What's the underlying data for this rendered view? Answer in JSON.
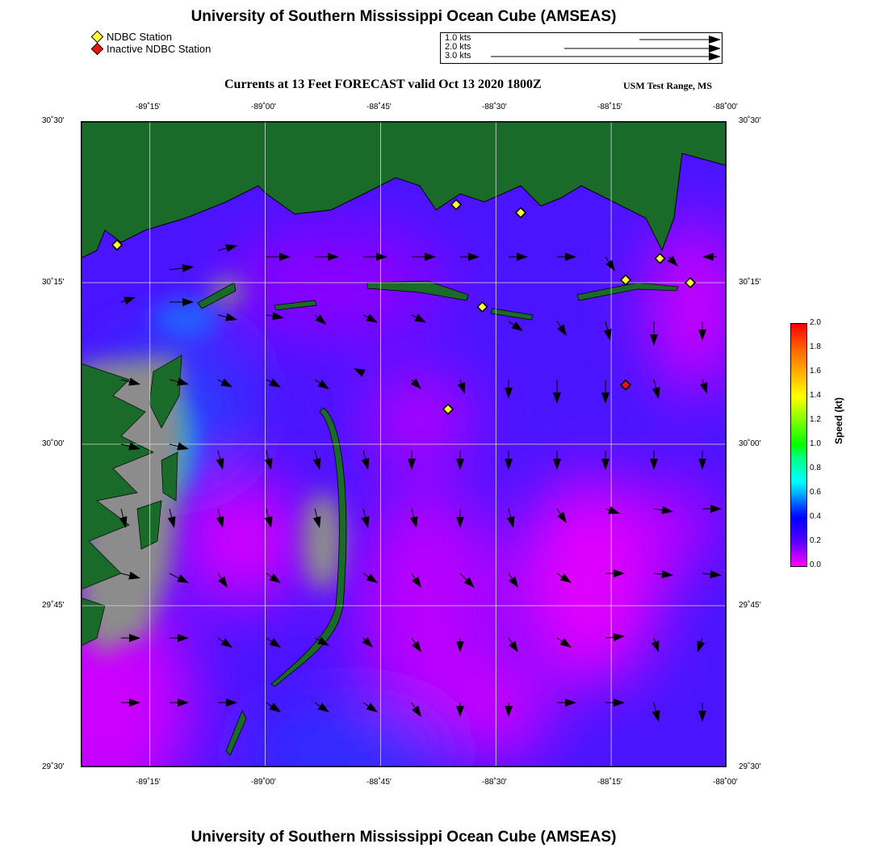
{
  "title": "University of Southern Mississippi Ocean Cube (AMSEAS)",
  "footer_title": "University of Southern Mississippi Ocean Cube (AMSEAS)",
  "legend": {
    "active": "NDBC Station",
    "inactive": "Inactive NDBC Station",
    "active_color": "#ffff33",
    "inactive_color": "#ee1111"
  },
  "speed_scale": [
    "1.0 kts",
    "2.0 kts",
    "3.0 kts"
  ],
  "subtitle": "Currents at 13 Feet FORECAST valid Oct 13 2020 1800Z",
  "region": "USM Test Range, MS",
  "lon_labels": [
    "-89˚15'",
    "-89˚00'",
    "-88˚45'",
    "-88˚30'",
    "-88˚15'",
    "-88˚00'"
  ],
  "lat_labels": [
    "30˚30'",
    "30˚15'",
    "30˚00'",
    "29˚45'",
    "29˚30'"
  ],
  "colorbar": {
    "title": "Speed (kt)",
    "ticks": [
      "0.0",
      "0.2",
      "0.4",
      "0.6",
      "0.8",
      "1.0",
      "1.2",
      "1.4",
      "1.6",
      "1.8",
      "2.0"
    ]
  },
  "colors": {
    "land": "#1a6a2a",
    "shallow": "#8c8c8c",
    "water_blue": "#3a10ff",
    "water_magenta": "#d000ff"
  },
  "map_extent": {
    "lon": [
      -89.3333,
      -88.0
    ],
    "lat": [
      29.5,
      30.5
    ]
  },
  "stations": [
    {
      "lon": -89.2583,
      "lat": 30.3083,
      "active": true
    },
    {
      "lon": -88.5583,
      "lat": 30.3708,
      "active": true
    },
    {
      "lon": -88.425,
      "lat": 30.3583,
      "active": true
    },
    {
      "lon": -88.1375,
      "lat": 30.2875,
      "active": true
    },
    {
      "lon": -88.2083,
      "lat": 30.2542,
      "active": true
    },
    {
      "lon": -88.075,
      "lat": 30.25,
      "active": true
    },
    {
      "lon": -88.5042,
      "lat": 30.2125,
      "active": true
    },
    {
      "lon": -88.575,
      "lat": 30.0542,
      "active": true
    },
    {
      "lon": -88.2083,
      "lat": 30.0917,
      "active": false
    }
  ],
  "current_vectors": [
    {
      "lon": -89.25,
      "lat": 30.22,
      "u": 0.15,
      "v": 0.05
    },
    {
      "lon": -89.15,
      "lat": 30.22,
      "u": 0.25,
      "v": 0.0
    },
    {
      "lon": -89.05,
      "lat": 30.2,
      "u": 0.2,
      "v": -0.05
    },
    {
      "lon": -88.95,
      "lat": 30.2,
      "u": 0.18,
      "v": -0.03
    },
    {
      "lon": -89.15,
      "lat": 30.27,
      "u": 0.25,
      "v": 0.03
    },
    {
      "lon": -89.05,
      "lat": 30.3,
      "u": 0.2,
      "v": 0.05
    },
    {
      "lon": -88.95,
      "lat": 30.29,
      "u": 0.25,
      "v": 0.0
    },
    {
      "lon": -88.85,
      "lat": 30.29,
      "u": 0.25,
      "v": 0.0
    },
    {
      "lon": -88.75,
      "lat": 30.29,
      "u": 0.25,
      "v": 0.0
    },
    {
      "lon": -88.65,
      "lat": 30.29,
      "u": 0.25,
      "v": 0.0
    },
    {
      "lon": -88.55,
      "lat": 30.29,
      "u": 0.2,
      "v": 0.0
    },
    {
      "lon": -88.45,
      "lat": 30.29,
      "u": 0.2,
      "v": 0.0
    },
    {
      "lon": -88.35,
      "lat": 30.29,
      "u": 0.2,
      "v": 0.0
    },
    {
      "lon": -88.25,
      "lat": 30.29,
      "u": 0.1,
      "v": -0.15
    },
    {
      "lon": -88.12,
      "lat": 30.29,
      "u": 0.1,
      "v": -0.1
    },
    {
      "lon": -88.02,
      "lat": 30.29,
      "u": -0.15,
      "v": 0.0
    },
    {
      "lon": -88.85,
      "lat": 30.2,
      "u": 0.12,
      "v": -0.1
    },
    {
      "lon": -88.75,
      "lat": 30.2,
      "u": 0.15,
      "v": -0.08
    },
    {
      "lon": -88.65,
      "lat": 30.2,
      "u": 0.15,
      "v": -0.08
    },
    {
      "lon": -88.45,
      "lat": 30.19,
      "u": 0.15,
      "v": -0.1
    },
    {
      "lon": -88.35,
      "lat": 30.19,
      "u": 0.1,
      "v": -0.15
    },
    {
      "lon": -88.25,
      "lat": 30.19,
      "u": 0.05,
      "v": -0.2
    },
    {
      "lon": -88.15,
      "lat": 30.19,
      "u": 0.0,
      "v": -0.25
    },
    {
      "lon": -88.05,
      "lat": 30.19,
      "u": 0.0,
      "v": -0.2
    },
    {
      "lon": -89.25,
      "lat": 30.1,
      "u": 0.2,
      "v": -0.05
    },
    {
      "lon": -89.15,
      "lat": 30.1,
      "u": 0.2,
      "v": -0.05
    },
    {
      "lon": -89.05,
      "lat": 30.1,
      "u": 0.15,
      "v": -0.08
    },
    {
      "lon": -88.95,
      "lat": 30.1,
      "u": 0.15,
      "v": -0.08
    },
    {
      "lon": -88.85,
      "lat": 30.1,
      "u": 0.15,
      "v": -0.1
    },
    {
      "lon": -88.75,
      "lat": 30.11,
      "u": -0.1,
      "v": 0.05
    },
    {
      "lon": -88.65,
      "lat": 30.1,
      "u": 0.1,
      "v": -0.1
    },
    {
      "lon": -88.55,
      "lat": 30.1,
      "u": 0.05,
      "v": -0.15
    },
    {
      "lon": -88.45,
      "lat": 30.1,
      "u": 0.0,
      "v": -0.2
    },
    {
      "lon": -88.35,
      "lat": 30.1,
      "u": 0.0,
      "v": -0.25
    },
    {
      "lon": -88.25,
      "lat": 30.1,
      "u": 0.0,
      "v": -0.25
    },
    {
      "lon": -88.15,
      "lat": 30.1,
      "u": 0.05,
      "v": -0.2
    },
    {
      "lon": -88.05,
      "lat": 30.1,
      "u": 0.05,
      "v": -0.15
    },
    {
      "lon": -89.25,
      "lat": 30.0,
      "u": 0.2,
      "v": -0.05
    },
    {
      "lon": -89.15,
      "lat": 30.0,
      "u": 0.2,
      "v": -0.05
    },
    {
      "lon": -89.05,
      "lat": 29.99,
      "u": 0.05,
      "v": -0.2
    },
    {
      "lon": -88.95,
      "lat": 29.99,
      "u": 0.05,
      "v": -0.2
    },
    {
      "lon": -88.85,
      "lat": 29.99,
      "u": 0.05,
      "v": -0.2
    },
    {
      "lon": -88.75,
      "lat": 29.99,
      "u": 0.05,
      "v": -0.2
    },
    {
      "lon": -88.65,
      "lat": 29.99,
      "u": 0.0,
      "v": -0.2
    },
    {
      "lon": -88.55,
      "lat": 29.99,
      "u": 0.0,
      "v": -0.2
    },
    {
      "lon": -88.45,
      "lat": 29.99,
      "u": 0.0,
      "v": -0.2
    },
    {
      "lon": -88.35,
      "lat": 29.99,
      "u": 0.0,
      "v": -0.2
    },
    {
      "lon": -88.25,
      "lat": 29.99,
      "u": 0.0,
      "v": -0.2
    },
    {
      "lon": -88.15,
      "lat": 29.99,
      "u": 0.0,
      "v": -0.2
    },
    {
      "lon": -88.05,
      "lat": 29.99,
      "u": 0.0,
      "v": -0.2
    },
    {
      "lon": -89.25,
      "lat": 29.9,
      "u": 0.05,
      "v": -0.2
    },
    {
      "lon": -89.15,
      "lat": 29.9,
      "u": 0.05,
      "v": -0.2
    },
    {
      "lon": -89.05,
      "lat": 29.9,
      "u": 0.05,
      "v": -0.2
    },
    {
      "lon": -88.95,
      "lat": 29.9,
      "u": 0.05,
      "v": -0.2
    },
    {
      "lon": -88.85,
      "lat": 29.9,
      "u": 0.05,
      "v": -0.2
    },
    {
      "lon": -88.75,
      "lat": 29.9,
      "u": 0.05,
      "v": -0.2
    },
    {
      "lon": -88.65,
      "lat": 29.9,
      "u": 0.05,
      "v": -0.2
    },
    {
      "lon": -88.55,
      "lat": 29.9,
      "u": 0.0,
      "v": -0.2
    },
    {
      "lon": -88.45,
      "lat": 29.9,
      "u": 0.05,
      "v": -0.2
    },
    {
      "lon": -88.35,
      "lat": 29.9,
      "u": 0.1,
      "v": -0.15
    },
    {
      "lon": -88.25,
      "lat": 29.9,
      "u": 0.15,
      "v": -0.05
    },
    {
      "lon": -88.15,
      "lat": 29.9,
      "u": 0.2,
      "v": -0.03
    },
    {
      "lon": -88.05,
      "lat": 29.9,
      "u": 0.2,
      "v": 0.0
    },
    {
      "lon": -89.25,
      "lat": 29.8,
      "u": 0.2,
      "v": -0.05
    },
    {
      "lon": -89.15,
      "lat": 29.8,
      "u": 0.2,
      "v": -0.1
    },
    {
      "lon": -89.05,
      "lat": 29.8,
      "u": 0.1,
      "v": -0.15
    },
    {
      "lon": -88.95,
      "lat": 29.8,
      "u": 0.15,
      "v": -0.1
    },
    {
      "lon": -88.75,
      "lat": 29.8,
      "u": 0.15,
      "v": -0.1
    },
    {
      "lon": -88.65,
      "lat": 29.8,
      "u": 0.1,
      "v": -0.15
    },
    {
      "lon": -88.55,
      "lat": 29.8,
      "u": 0.15,
      "v": -0.15
    },
    {
      "lon": -88.45,
      "lat": 29.8,
      "u": 0.1,
      "v": -0.15
    },
    {
      "lon": -88.35,
      "lat": 29.8,
      "u": 0.15,
      "v": -0.1
    },
    {
      "lon": -88.25,
      "lat": 29.8,
      "u": 0.2,
      "v": 0.0
    },
    {
      "lon": -88.15,
      "lat": 29.8,
      "u": 0.2,
      "v": -0.02
    },
    {
      "lon": -88.05,
      "lat": 29.8,
      "u": 0.2,
      "v": -0.02
    },
    {
      "lon": -89.25,
      "lat": 29.7,
      "u": 0.2,
      "v": 0.0
    },
    {
      "lon": -89.15,
      "lat": 29.7,
      "u": 0.2,
      "v": 0.0
    },
    {
      "lon": -89.05,
      "lat": 29.7,
      "u": 0.15,
      "v": -0.1
    },
    {
      "lon": -88.95,
      "lat": 29.7,
      "u": 0.15,
      "v": -0.1
    },
    {
      "lon": -88.85,
      "lat": 29.7,
      "u": 0.15,
      "v": -0.08
    },
    {
      "lon": -88.75,
      "lat": 29.7,
      "u": 0.1,
      "v": -0.1
    },
    {
      "lon": -88.65,
      "lat": 29.7,
      "u": 0.1,
      "v": -0.15
    },
    {
      "lon": -88.55,
      "lat": 29.7,
      "u": 0.0,
      "v": -0.15
    },
    {
      "lon": -88.45,
      "lat": 29.7,
      "u": 0.1,
      "v": -0.15
    },
    {
      "lon": -88.35,
      "lat": 29.7,
      "u": 0.15,
      "v": -0.1
    },
    {
      "lon": -88.25,
      "lat": 29.7,
      "u": 0.2,
      "v": 0.02
    },
    {
      "lon": -88.15,
      "lat": 29.7,
      "u": 0.05,
      "v": -0.15
    },
    {
      "lon": -88.05,
      "lat": 29.7,
      "u": -0.05,
      "v": -0.15
    },
    {
      "lon": -89.25,
      "lat": 29.6,
      "u": 0.2,
      "v": 0.0
    },
    {
      "lon": -89.15,
      "lat": 29.6,
      "u": 0.2,
      "v": 0.0
    },
    {
      "lon": -89.05,
      "lat": 29.6,
      "u": 0.2,
      "v": 0.0
    },
    {
      "lon": -88.95,
      "lat": 29.6,
      "u": 0.15,
      "v": -0.1
    },
    {
      "lon": -88.85,
      "lat": 29.6,
      "u": 0.15,
      "v": -0.1
    },
    {
      "lon": -88.75,
      "lat": 29.6,
      "u": 0.15,
      "v": -0.1
    },
    {
      "lon": -88.65,
      "lat": 29.6,
      "u": 0.1,
      "v": -0.15
    },
    {
      "lon": -88.55,
      "lat": 29.6,
      "u": 0.0,
      "v": -0.15
    },
    {
      "lon": -88.45,
      "lat": 29.6,
      "u": 0.0,
      "v": -0.15
    },
    {
      "lon": -88.35,
      "lat": 29.6,
      "u": 0.2,
      "v": 0.0
    },
    {
      "lon": -88.25,
      "lat": 29.6,
      "u": 0.2,
      "v": 0.0
    },
    {
      "lon": -88.15,
      "lat": 29.6,
      "u": 0.05,
      "v": -0.2
    },
    {
      "lon": -88.05,
      "lat": 29.6,
      "u": 0.0,
      "v": -0.2
    }
  ]
}
